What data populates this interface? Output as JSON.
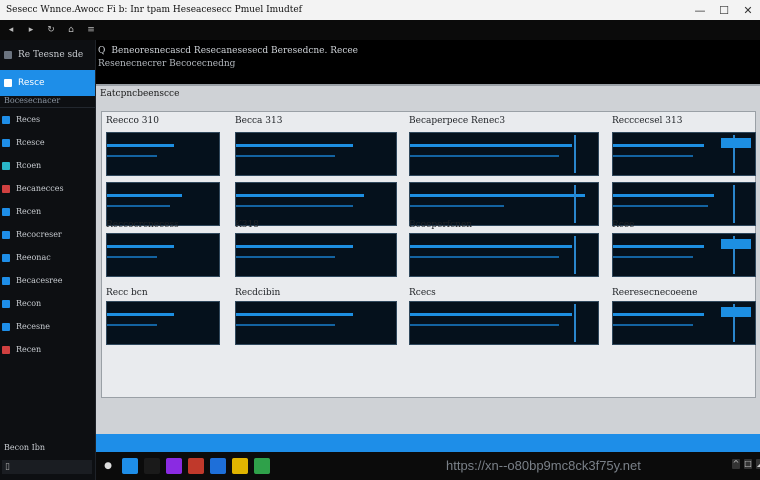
{
  "window": {
    "title": "Sesecc Wnnce.Awocc Fi b: Inr tpam Heseacesecc Pmuel Imudtef",
    "controls": {
      "minimize": "—",
      "maximize": "☐",
      "close": "✕"
    }
  },
  "toolbar": {
    "icons": [
      "back-icon",
      "forward-icon",
      "refresh-icon",
      "home-icon",
      "menu-icon"
    ]
  },
  "sidebar": {
    "header": "Re Teesne sde",
    "active_item": "Resce",
    "group_label": "Bocesecnacer",
    "items": [
      {
        "label": "Reces",
        "icon_color": "#1e8ee8"
      },
      {
        "label": "Rcesce",
        "icon_color": "#1e8ee8"
      },
      {
        "label": "Rcoen",
        "icon_color": "#29b6c8"
      },
      {
        "label": "Becanecces",
        "icon_color": "#d04040"
      },
      {
        "label": "Recen",
        "icon_color": "#1e8ee8"
      },
      {
        "label": "Recocreser",
        "icon_color": "#1e8ee8"
      },
      {
        "label": "Reeonac",
        "icon_color": "#1e8ee8"
      },
      {
        "label": "Becacesree",
        "icon_color": "#1e8ee8"
      },
      {
        "label": "Recon",
        "icon_color": "#1e8ee8"
      },
      {
        "label": "Recesne",
        "icon_color": "#1e8ee8"
      },
      {
        "label": "Recen",
        "icon_color": "#d04040"
      }
    ],
    "bottom_label": "Becon Ibn",
    "search_glyph": "▯"
  },
  "header": {
    "glyph": "Q",
    "line1": "Beneoresnecascd Resecanesesecd Beresedcne. Recee",
    "line2": "Resenecnecrer Becocecnedng"
  },
  "panel": {
    "title": "Eatcpncbeenscce",
    "columns": [
      {
        "row1": "Reecco 310",
        "row2": "Reccocrcnecess",
        "row3": "Recc bcn"
      },
      {
        "row1": "Becca 313",
        "row2": "K318",
        "row3": "Recdcibin"
      },
      {
        "row1": "Becaperpece Renec3",
        "row2": "Bcoeperfcnen",
        "row3": "Rcecs"
      },
      {
        "row1": "Recccecsel 313",
        "row2": "Rcee",
        "row3": "Reeresecnecoeene"
      }
    ]
  },
  "taskbar": {
    "start_glyph": "●",
    "apps": [
      {
        "name": "edge-icon",
        "color": "#1e8ee8"
      },
      {
        "name": "terminal-icon",
        "color": "#1a1a1a"
      },
      {
        "name": "media-icon",
        "color": "#8a2be2"
      },
      {
        "name": "store-icon",
        "color": "#c0392b"
      },
      {
        "name": "photos-icon",
        "color": "#1e6fd9"
      },
      {
        "name": "folder-icon",
        "color": "#e0b400"
      },
      {
        "name": "sheets-icon",
        "color": "#2fa14a"
      }
    ],
    "tray_text": "https://xn--o80bp9mc8ck3f75y.net",
    "tray_icons": [
      "^",
      "□",
      "◢",
      "ᛒ"
    ]
  },
  "colors": {
    "accent": "#1e8ee8",
    "tile_bg": "#05111c",
    "panel_bg": "#cfd2d6"
  }
}
